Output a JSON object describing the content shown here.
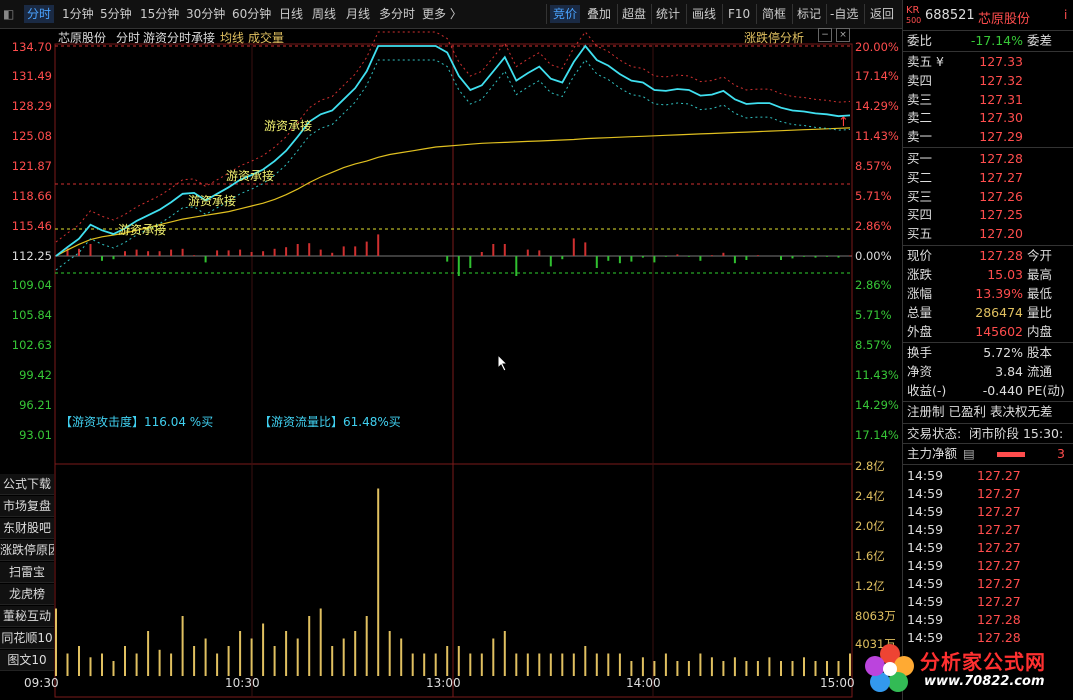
{
  "toolbar": {
    "items": [
      "分时",
      "1分钟",
      "5分钟",
      "15分钟",
      "30分钟",
      "60分钟",
      "日线",
      "周线",
      "月线",
      "多分时",
      "更多 〉"
    ],
    "right_items": [
      "竞价",
      "叠加",
      "超盘",
      "统计",
      "画线",
      "F10",
      "简框",
      "标记",
      "-自选",
      "返回"
    ]
  },
  "chart_header": {
    "name": "芯原股份",
    "mode": "分时",
    "indicator": "游资分时承接",
    "avg_line": "均线",
    "volume": "成交量",
    "limit_analysis": "涨跌停分析"
  },
  "price_axis": {
    "left": [
      "134.70",
      "131.49",
      "128.29",
      "125.08",
      "121.87",
      "118.66",
      "115.46",
      "112.25",
      "109.04",
      "105.84",
      "102.63",
      "99.42",
      "96.21",
      "93.01"
    ],
    "right": [
      "20.00%",
      "17.14%",
      "14.29%",
      "11.43%",
      "8.57%",
      "5.71%",
      "2.86%",
      "0.00%",
      "2.86%",
      "5.71%",
      "8.57%",
      "11.43%",
      "14.29%",
      "17.14%"
    ]
  },
  "volume_axis": [
    "2.8亿",
    "2.4亿",
    "2.0亿",
    "1.6亿",
    "1.2亿",
    "8063万",
    "4031万"
  ],
  "time_axis": [
    "09:30",
    "10:30",
    "13:00",
    "14:00",
    "15:00"
  ],
  "annotations": {
    "chengjie": "游资承接",
    "attack": "【游资攻击度】116.04 %买",
    "flow": "【游资流量比】61.48%买"
  },
  "left_buttons": [
    "公式下载",
    "市场复盘",
    "东财股吧",
    "涨跌停原因",
    "扫雷宝",
    "龙虎榜",
    "董秘互动",
    "同花顺10",
    "图文10"
  ],
  "stock": {
    "badge_top": "KR",
    "badge_bottom": "500",
    "code": "688521",
    "name": "芯原股份"
  },
  "order_book": {
    "weibi_label": "委比",
    "weibi_value": "-17.14%",
    "weicha_label": "委差",
    "asks": [
      {
        "label": "卖五 ¥",
        "price": "127.33"
      },
      {
        "label": "卖四",
        "price": "127.32"
      },
      {
        "label": "卖三",
        "price": "127.31"
      },
      {
        "label": "卖二",
        "price": "127.30"
      },
      {
        "label": "卖一",
        "price": "127.29"
      }
    ],
    "bids": [
      {
        "label": "买一",
        "price": "127.28"
      },
      {
        "label": "买二",
        "price": "127.27"
      },
      {
        "label": "买三",
        "price": "127.26"
      },
      {
        "label": "买四",
        "price": "127.25"
      },
      {
        "label": "买五",
        "price": "127.20"
      }
    ]
  },
  "quote": [
    {
      "k": "现价",
      "v": "127.28",
      "k2": "今开",
      "c": "red"
    },
    {
      "k": "涨跌",
      "v": "15.03",
      "k2": "最高",
      "c": "red"
    },
    {
      "k": "涨幅",
      "v": "13.39%",
      "k2": "最低",
      "c": "red"
    },
    {
      "k": "总量",
      "v": "286474",
      "k2": "量比",
      "c": "yel"
    },
    {
      "k": "外盘",
      "v": "145602",
      "k2": "内盘",
      "c": "red"
    }
  ],
  "fundamentals": [
    {
      "k": "换手",
      "v": "5.72%",
      "k2": "股本",
      "c": "wht"
    },
    {
      "k": "净资",
      "v": "3.84",
      "k2": "流通",
      "c": "wht"
    },
    {
      "k": "收益(-)",
      "v": "-0.440",
      "k2": "PE(动)",
      "c": "wht"
    }
  ],
  "info_line1": "注册制 已盈利 表决权无差",
  "info_line2_label": "交易状态:",
  "info_line2_value": "闭市阶段 15:30:",
  "main_net": {
    "label": "主力净额",
    "value": "3"
  },
  "ticks": [
    {
      "t": "14:59",
      "p": "127.27"
    },
    {
      "t": "14:59",
      "p": "127.27"
    },
    {
      "t": "14:59",
      "p": "127.27"
    },
    {
      "t": "14:59",
      "p": "127.27"
    },
    {
      "t": "14:59",
      "p": "127.27"
    },
    {
      "t": "14:59",
      "p": "127.27"
    },
    {
      "t": "14:59",
      "p": "127.27"
    },
    {
      "t": "14:59",
      "p": "127.27"
    },
    {
      "t": "14:59",
      "p": "127.28"
    },
    {
      "t": "14:59",
      "p": "127.28"
    }
  ],
  "logo": {
    "text": "分析家公式网",
    "url": "www.70822.com"
  },
  "chart_data": {
    "type": "line",
    "prev_close": 112.25,
    "price": [
      112.25,
      113.2,
      114.1,
      115.6,
      115.0,
      114.6,
      115.2,
      116.0,
      116.6,
      117.2,
      118.0,
      118.9,
      119.0,
      118.2,
      118.9,
      119.6,
      120.4,
      120.9,
      121.5,
      122.4,
      123.5,
      125.0,
      126.6,
      127.4,
      127.8,
      129.0,
      130.2,
      132.0,
      134.7,
      134.7,
      134.7,
      134.7,
      134.7,
      134.7,
      134.0,
      131.5,
      130.0,
      130.5,
      132.0,
      133.5,
      131.0,
      131.8,
      132.5,
      131.2,
      130.8,
      133.0,
      134.7,
      133.2,
      132.6,
      131.7,
      131.0,
      130.8,
      130.0,
      129.9,
      130.1,
      130.0,
      129.4,
      129.5,
      129.9,
      129.0,
      128.5,
      128.6,
      128.6,
      128.1,
      127.8,
      127.7,
      127.5,
      127.4,
      127.2,
      127.28
    ],
    "avg": [
      112.25,
      112.9,
      113.5,
      114.0,
      114.3,
      114.5,
      114.7,
      115.0,
      115.3,
      115.6,
      115.9,
      116.2,
      116.4,
      116.6,
      116.8,
      117.0,
      117.3,
      117.6,
      117.9,
      118.3,
      118.8,
      119.4,
      120.1,
      120.7,
      121.2,
      121.7,
      122.1,
      122.4,
      122.8,
      123.1,
      123.3,
      123.5,
      123.7,
      123.9,
      124.0,
      124.1,
      124.2,
      124.3,
      124.35,
      124.4,
      124.45,
      124.5,
      124.55,
      124.6,
      124.65,
      124.7,
      124.8,
      124.85,
      124.9,
      124.95,
      125.0,
      125.05,
      125.1,
      125.15,
      125.2,
      125.25,
      125.3,
      125.35,
      125.4,
      125.45,
      125.5,
      125.55,
      125.6,
      125.65,
      125.7,
      125.75,
      125.8,
      125.85,
      125.9,
      125.95
    ],
    "volume": [
      0.9,
      0.3,
      0.4,
      0.25,
      0.3,
      0.2,
      0.4,
      0.3,
      0.6,
      0.35,
      0.3,
      0.8,
      0.4,
      0.5,
      0.3,
      0.4,
      0.6,
      0.5,
      0.7,
      0.4,
      0.6,
      0.5,
      0.8,
      0.9,
      0.4,
      0.5,
      0.6,
      0.8,
      2.5,
      0.6,
      0.5,
      0.3,
      0.3,
      0.3,
      0.4,
      0.4,
      0.3,
      0.3,
      0.5,
      0.6,
      0.3,
      0.3,
      0.3,
      0.3,
      0.3,
      0.3,
      0.4,
      0.3,
      0.3,
      0.3,
      0.2,
      0.25,
      0.2,
      0.3,
      0.2,
      0.2,
      0.3,
      0.25,
      0.2,
      0.25,
      0.2,
      0.2,
      0.25,
      0.2,
      0.2,
      0.25,
      0.2,
      0.2,
      0.2,
      0.3
    ],
    "ylim": [
      93.01,
      134.7
    ],
    "volume_ylim_yi": [
      0,
      2.8
    ]
  }
}
